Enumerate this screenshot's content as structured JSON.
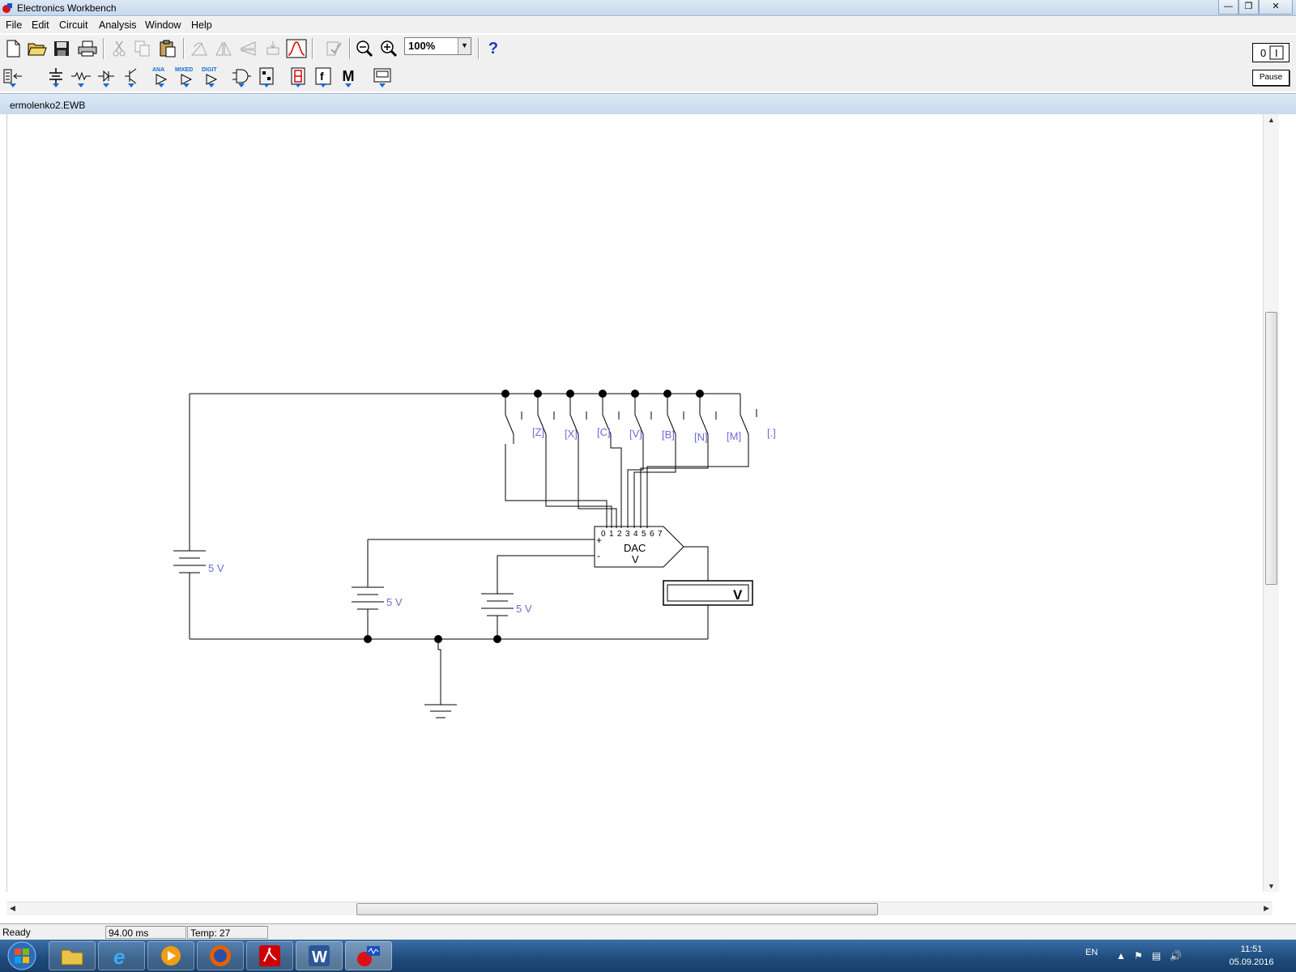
{
  "window": {
    "title": "Electronics Workbench"
  },
  "menu": [
    "File",
    "Edit",
    "Circuit",
    "Analysis",
    "Window",
    "Help"
  ],
  "toolbar": {
    "zoom_value": "100%",
    "help_label": "?",
    "pause_label": "Pause"
  },
  "parts_bin": {
    "analog_label": "ANA",
    "mixed_label": "MIXED",
    "digital_label": "DIGIT",
    "misc_label": "M"
  },
  "document": {
    "title": "ermolenko2.EWB"
  },
  "circuit": {
    "battery_labels": [
      "5 V",
      "5 V",
      "5 V"
    ],
    "switch_keys": [
      "[Z]",
      "[X]",
      "[C]",
      "[V]",
      "[B]",
      "[N]",
      "[M]",
      "[.]"
    ],
    "dac_pins": [
      "0",
      "1",
      "2",
      "3",
      "4",
      "5",
      "6",
      "7"
    ],
    "dac_label": "DAC",
    "dac_sub": "V",
    "dac_plus": "+",
    "dac_minus": "-",
    "voltmeter_label": "V"
  },
  "status": {
    "state": "Ready",
    "time": "94.00 ms",
    "temp": "Temp:  27"
  },
  "taskbar": {
    "language": "EN",
    "time": "11:51",
    "date": "05.09.2016"
  },
  "colors": {
    "label_blue": "#6b6bd6",
    "title_bar": "#c7d8ec"
  }
}
